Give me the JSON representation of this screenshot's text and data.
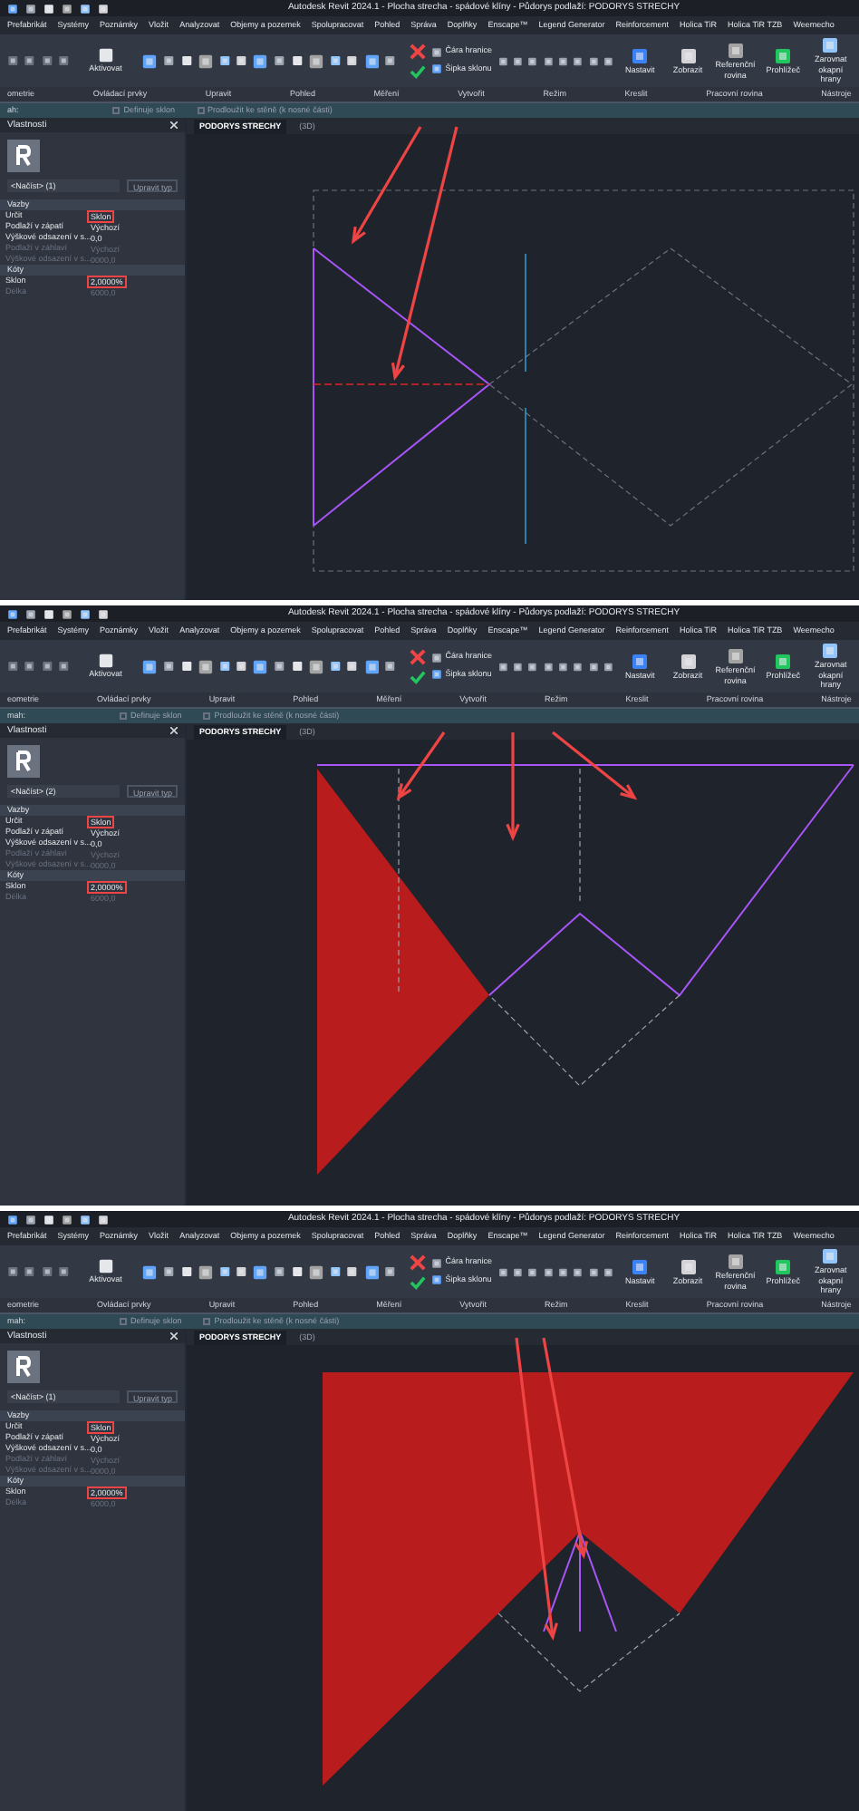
{
  "panels": [
    {
      "kind": "sketch",
      "title": "Autodesk Revit 2024.1 - Plocha strecha - spádové klíny - Půdorys podlaží: PODORYS STRECHY",
      "menu": [
        "Prefabrikát",
        "Systémy",
        "Poznámky",
        "Vložit",
        "Analyzovat",
        "Objemy a pozemek",
        "Spolupracovat",
        "Pohled",
        "Správa",
        "Doplňky",
        "Enscape™",
        "Legend Generator",
        "Reinforcement",
        "Holica TiR",
        "Holica TiR TZB",
        "Weemecho"
      ],
      "ribbon": {
        "aktivovat": "Aktivovat",
        "mode_tools": [
          "Čára hranice",
          "Šipka sklonu"
        ],
        "plane_tools": [
          "Nastavit",
          "Zobrazit",
          "Referenční rovina",
          "Prohlížeč",
          "Zarovnat okapní hrany"
        ],
        "groups": [
          "ometrie",
          "Ovládací prvky",
          "Upravit",
          "Pohled",
          "Měření",
          "Vytvořit",
          "Režim",
          "Kreslit",
          "Pracovní rovina",
          "Nástroje"
        ]
      },
      "options_bar": {
        "label": "ah:",
        "options": [
          {
            "label": "Definuje sklon",
            "checked": false
          },
          {
            "label": "Prodloužit ke stěně (k nosné části)",
            "checked": false
          }
        ]
      },
      "properties": {
        "title": "Vlastnosti",
        "type": "<Načíst> (1)",
        "edit_type": "Upravit typ",
        "sections": [
          {
            "name": "Vazby",
            "rows": [
              {
                "label": "Určit",
                "value": "Sklon",
                "disabled": false,
                "highlighted": true
              },
              {
                "label": "Podlaží v zápatí",
                "value": "Výchozí",
                "disabled": false,
                "highlighted": false
              },
              {
                "label": "Výškové odsazení v s...",
                "value": "0,0",
                "disabled": false,
                "highlighted": false
              },
              {
                "label": "Podlaží v záhlaví",
                "value": "Výchozí",
                "disabled": true,
                "highlighted": false
              },
              {
                "label": "Výškové odsazení v s...",
                "value": "0000,0",
                "disabled": true,
                "highlighted": false
              }
            ]
          },
          {
            "name": "Kóty",
            "rows": [
              {
                "label": "Sklon",
                "value": "2,0000%",
                "disabled": false,
                "highlighted": true
              },
              {
                "label": "Délka",
                "value": "6000,0",
                "disabled": true,
                "highlighted": false
              }
            ]
          }
        ]
      },
      "view_tabs": [
        {
          "label": "PODORYS STRECHY",
          "selected": true
        },
        {
          "label": "(3D)",
          "selected": false
        }
      ]
    },
    {
      "kind": "partial",
      "title": "Autodesk Revit 2024.1 - Plocha strecha - spádové klíny - Půdorys podlaží: PODORYS STRECHY",
      "menu": [
        "Prefabrikát",
        "Systémy",
        "Poznámky",
        "Vložit",
        "Analyzovat",
        "Objemy a pozemek",
        "Spolupracovat",
        "Pohled",
        "Správa",
        "Doplňky",
        "Enscape™",
        "Legend Generator",
        "Reinforcement",
        "Holica TiR",
        "Holica TiR TZB",
        "Weemecho"
      ],
      "ribbon": {
        "aktivovat": "Aktivovat",
        "mode_tools": [
          "Čára hranice",
          "Šipka sklonu"
        ],
        "plane_tools": [
          "Nastavit",
          "Zobrazit",
          "Referenční rovina",
          "Prohlížeč",
          "Zarovnat okapní hrany"
        ],
        "groups": [
          "eometrie",
          "Ovládací prvky",
          "Upravit",
          "Pohled",
          "Měření",
          "Vytvořit",
          "Režim",
          "Kreslit",
          "Pracovní rovina",
          "Nástroje"
        ]
      },
      "options_bar": {
        "label": "mah:",
        "options": [
          {
            "label": "Definuje sklon",
            "checked": false
          },
          {
            "label": "Prodloužit ke stěně (k nosné části)",
            "checked": false
          }
        ]
      },
      "properties": {
        "title": "Vlastnosti",
        "type": "<Načíst> (2)",
        "edit_type": "Upravit typ",
        "sections": [
          {
            "name": "Vazby",
            "rows": [
              {
                "label": "Určit",
                "value": "Sklon",
                "disabled": false,
                "highlighted": true
              },
              {
                "label": "Podlaží v zápatí",
                "value": "Výchozí",
                "disabled": false,
                "highlighted": false
              },
              {
                "label": "Výškové odsazení v s...",
                "value": "0,0",
                "disabled": false,
                "highlighted": false
              },
              {
                "label": "Podlaží v záhlaví",
                "value": "Výchozí",
                "disabled": true,
                "highlighted": false
              },
              {
                "label": "Výškové odsazení v s...",
                "value": "0000,0",
                "disabled": true,
                "highlighted": false
              }
            ]
          },
          {
            "name": "Kóty",
            "rows": [
              {
                "label": "Sklon",
                "value": "2,0000%",
                "disabled": false,
                "highlighted": true
              },
              {
                "label": "Délka",
                "value": "6000,0",
                "disabled": true,
                "highlighted": false
              }
            ]
          }
        ]
      },
      "view_tabs": [
        {
          "label": "PODORYS STRECHY",
          "selected": true
        },
        {
          "label": "(3D)",
          "selected": false
        }
      ]
    },
    {
      "kind": "full",
      "title": "Autodesk Revit 2024.1 - Plocha strecha - spádové klíny - Půdorys podlaží: PODORYS STRECHY",
      "menu": [
        "Prefabrikát",
        "Systémy",
        "Poznámky",
        "Vložit",
        "Analyzovat",
        "Objemy a pozemek",
        "Spolupracovat",
        "Pohled",
        "Správa",
        "Doplňky",
        "Enscape™",
        "Legend Generator",
        "Reinforcement",
        "Holica TiR",
        "Holica TiR TZB",
        "Weemecho"
      ],
      "ribbon": {
        "aktivovat": "Aktivovat",
        "mode_tools": [
          "Čára hranice",
          "Šipka sklonu"
        ],
        "plane_tools": [
          "Nastavit",
          "Zobrazit",
          "Referenční rovina",
          "Prohlížeč",
          "Zarovnat okapní hrany"
        ],
        "groups": [
          "eometrie",
          "Ovládací prvky",
          "Upravit",
          "Pohled",
          "Měření",
          "Vytvořit",
          "Režim",
          "Kreslit",
          "Pracovní rovina",
          "Nástroje"
        ]
      },
      "options_bar": {
        "label": "mah:",
        "options": [
          {
            "label": "Definuje sklon",
            "checked": false
          },
          {
            "label": "Prodloužit ke stěně (k nosné části)",
            "checked": false
          }
        ]
      },
      "properties": {
        "title": "Vlastnosti",
        "type": "<Načíst> (1)",
        "edit_type": "Upravit typ",
        "sections": [
          {
            "name": "Vazby",
            "rows": [
              {
                "label": "Určit",
                "value": "Sklon",
                "disabled": false,
                "highlighted": true
              },
              {
                "label": "Podlaží v zápatí",
                "value": "Výchozí",
                "disabled": false,
                "highlighted": false
              },
              {
                "label": "Výškové odsazení v s...",
                "value": "0,0",
                "disabled": false,
                "highlighted": false
              },
              {
                "label": "Podlaží v záhlaví",
                "value": "Výchozí",
                "disabled": true,
                "highlighted": false
              },
              {
                "label": "Výškové odsazení v s...",
                "value": "0000,0",
                "disabled": true,
                "highlighted": false
              }
            ]
          },
          {
            "name": "Kóty",
            "rows": [
              {
                "label": "Sklon",
                "value": "2,0000%",
                "disabled": false,
                "highlighted": true
              },
              {
                "label": "Délka",
                "value": "6000,0",
                "disabled": true,
                "highlighted": false
              }
            ]
          }
        ]
      },
      "view_tabs": [
        {
          "label": "PODORYS STRECHY",
          "selected": true
        },
        {
          "label": "(3D)",
          "selected": false
        }
      ]
    }
  ]
}
